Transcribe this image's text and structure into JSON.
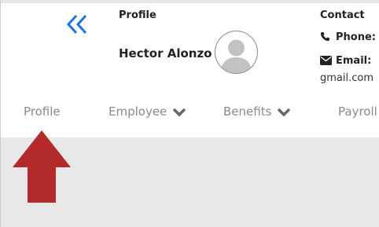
{
  "header": {
    "profile_label": "Profile",
    "user_name": "Hector Alonzo",
    "contact_label": "Contact",
    "phone_label": "Phone:",
    "email_label": "Email:",
    "email_value_tail": "gmail.com"
  },
  "tabs": [
    {
      "label": "Profile",
      "has_dropdown": false
    },
    {
      "label": "Employee",
      "has_dropdown": true
    },
    {
      "label": "Benefits",
      "has_dropdown": true
    },
    {
      "label": "Payroll",
      "has_dropdown": false
    }
  ],
  "icons": {
    "collapse": "double-chevron-left-icon",
    "avatar": "user-silhouette-icon",
    "phone": "phone-icon",
    "email": "envelope-icon",
    "dropdown": "chevron-down-icon",
    "annotation": "red-up-arrow"
  },
  "colors": {
    "accent": "#1a73e8",
    "tab_text": "#8a8a8a",
    "content_bg": "#e8e8e8",
    "annotation_arrow": "#b22a2a"
  }
}
